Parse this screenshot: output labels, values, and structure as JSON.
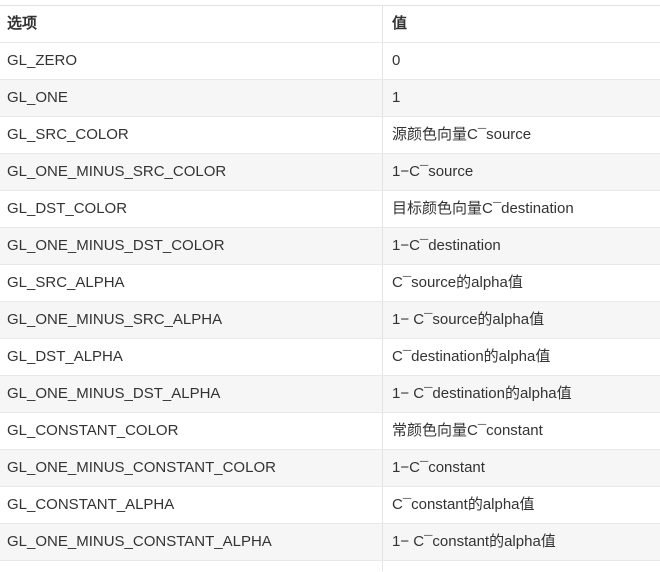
{
  "table": {
    "headers": [
      "选项",
      "值"
    ],
    "rows": [
      [
        "GL_ZERO",
        "0"
      ],
      [
        "GL_ONE",
        "1"
      ],
      [
        "GL_SRC_COLOR",
        "源颜色向量C¯source"
      ],
      [
        "GL_ONE_MINUS_SRC_COLOR",
        "1−C¯source"
      ],
      [
        "GL_DST_COLOR",
        "目标颜色向量C¯destination"
      ],
      [
        "GL_ONE_MINUS_DST_COLOR",
        "1−C¯destination"
      ],
      [
        "GL_SRC_ALPHA",
        "C¯source的alpha值"
      ],
      [
        "GL_ONE_MINUS_SRC_ALPHA",
        "1− C¯source的alpha值"
      ],
      [
        "GL_DST_ALPHA",
        "C¯destination的alpha值"
      ],
      [
        "GL_ONE_MINUS_DST_ALPHA",
        "1− C¯destination的alpha值"
      ],
      [
        "GL_CONSTANT_COLOR",
        "常颜色向量C¯constant"
      ],
      [
        "GL_ONE_MINUS_CONSTANT_COLOR",
        "1−C¯constant"
      ],
      [
        "GL_CONSTANT_ALPHA",
        "C¯constant的alpha值"
      ],
      [
        "GL_ONE_MINUS_CONSTANT_ALPHA",
        "1− C¯constant的alpha值"
      ]
    ]
  }
}
